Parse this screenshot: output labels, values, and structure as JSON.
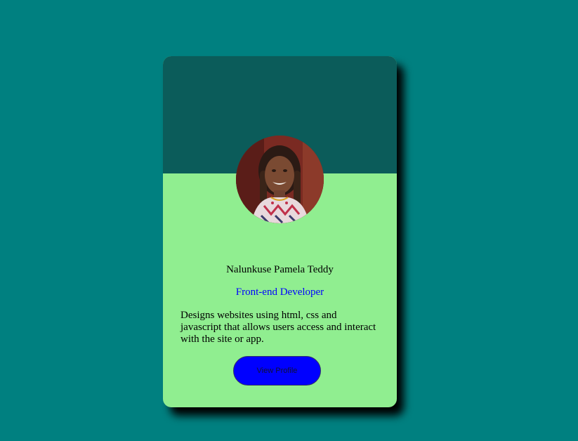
{
  "profile": {
    "name": "Nalunkuse Pamela Teddy",
    "role": "Front-end Developer",
    "bio": "Designs websites using html, css and javascript that allows users access and interact with the site or app.",
    "button_label": "View Profile"
  },
  "colors": {
    "page_background": "#008080",
    "card_header": "#0b5c5a",
    "card_body": "#90ee90",
    "role_text": "#0000ff",
    "button_background": "#0000ff"
  }
}
